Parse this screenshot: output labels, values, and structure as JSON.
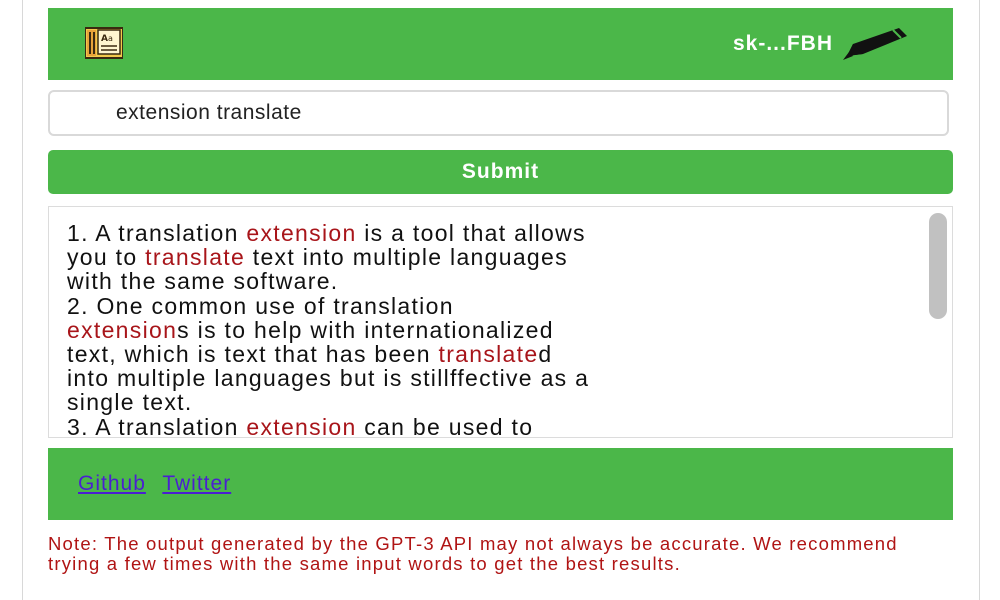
{
  "header": {
    "logo_icon": "notepad-translate-icon",
    "api_key_masked": "sk-...FBH",
    "edit_icon": "pencil-icon"
  },
  "input": {
    "value": "extension translate"
  },
  "submit_label": "Submit",
  "output": {
    "lines": [
      [
        {
          "t": "1. A translation "
        },
        {
          "t": "extension",
          "hl": true
        },
        {
          "t": " is a tool that allows"
        }
      ],
      [
        {
          "t": "you to "
        },
        {
          "t": "translate",
          "hl": true
        },
        {
          "t": " text into multiple languages"
        }
      ],
      [
        {
          "t": "with the same software."
        }
      ],
      [
        {
          "t": "2. One common use of translation"
        }
      ],
      [
        {
          "t": "extension",
          "hl": true
        },
        {
          "t": "s is to help with internationalized"
        }
      ],
      [
        {
          "t": "text, which is text that has been "
        },
        {
          "t": "translate",
          "hl": true
        },
        {
          "t": "d"
        }
      ],
      [
        {
          "t": "into multiple languages but is stillffective as a"
        }
      ],
      [
        {
          "t": "single text."
        }
      ],
      [
        {
          "t": "3. A translation "
        },
        {
          "t": "extension",
          "hl": true
        },
        {
          "t": " can be used to"
        }
      ]
    ]
  },
  "footer": {
    "links": [
      "Github",
      "Twitter"
    ]
  },
  "note": "Note: The output generated by the GPT-3 API may not always be accurate. We recommend trying a few times with the same input words to get the best results.",
  "colors": {
    "green": "#4bb749",
    "highlight": "#a8151a",
    "link": "#4b1fd1",
    "note": "#b01414"
  }
}
